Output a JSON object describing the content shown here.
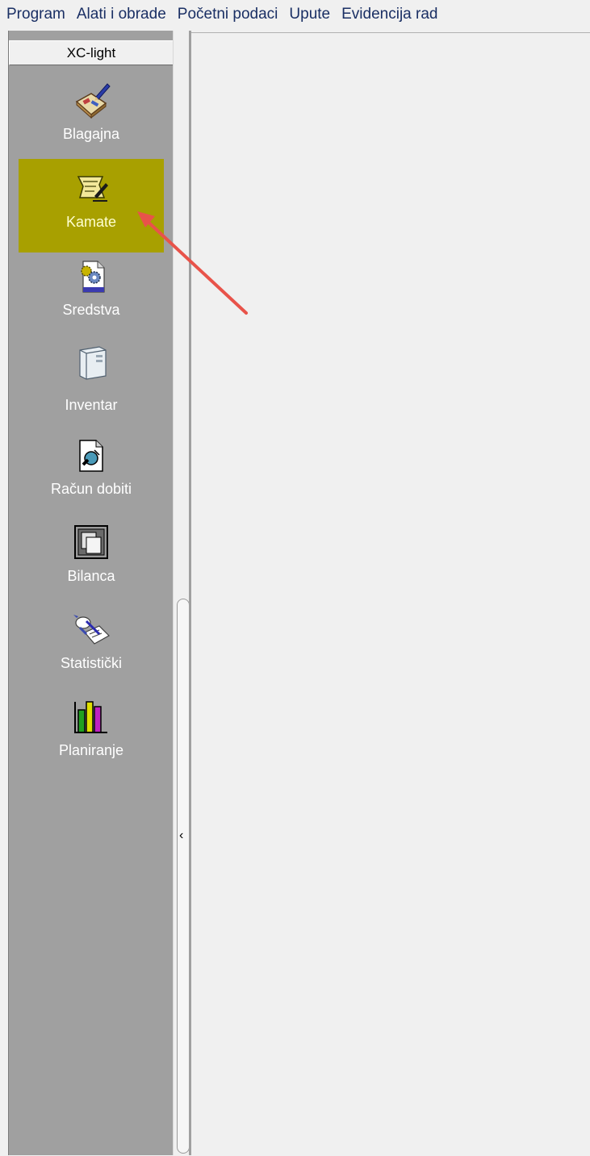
{
  "menu": [
    "Program",
    "Alati i obrade",
    "Početni podaci",
    "Upute",
    "Evidencija rad"
  ],
  "sidebar": {
    "header": "XC-light",
    "items": [
      {
        "label": "Blagajna",
        "icon": "cashbook-icon",
        "active": false
      },
      {
        "label": "Kamate",
        "icon": "document-pen-icon",
        "active": true
      },
      {
        "label": "Sredstva",
        "icon": "gears-document-icon",
        "active": false
      },
      {
        "label": "Inventar",
        "icon": "computer-tower-icon",
        "active": false
      },
      {
        "label": "Račun dobiti",
        "icon": "page-magnifier-icon",
        "active": false
      },
      {
        "label": "Bilanca",
        "icon": "stacked-pages-icon",
        "active": false
      },
      {
        "label": "Statistički",
        "icon": "hand-writing-icon",
        "active": false
      },
      {
        "label": "Planiranje",
        "icon": "bar-chart-icon",
        "active": false
      }
    ]
  },
  "colors": {
    "sidebar_bg": "#a0a0a0",
    "active_bg": "#a8a000",
    "menu_text": "#1a2f64",
    "annotation_arrow": "#e8534a"
  }
}
